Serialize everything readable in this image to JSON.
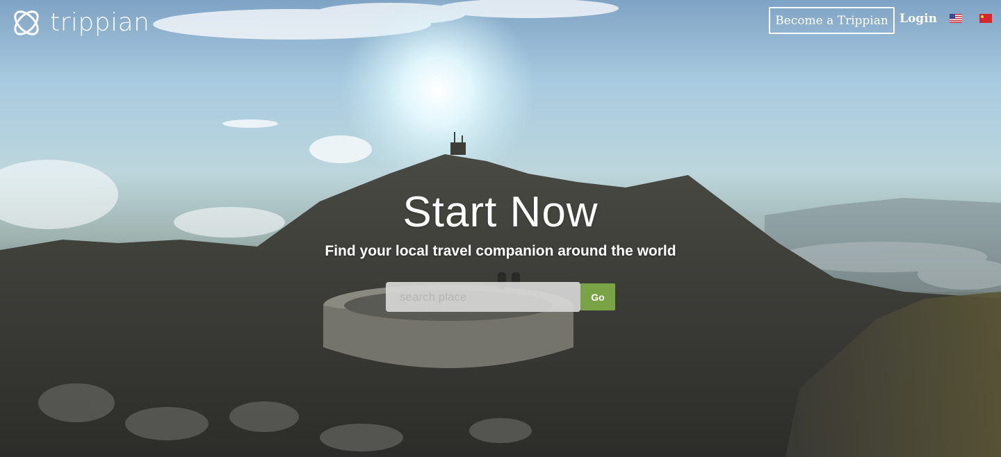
{
  "brand": {
    "name": "trippian"
  },
  "nav": {
    "become_label": "Become a Trippian",
    "login_label": "Login",
    "languages": [
      "English",
      "Chinese"
    ]
  },
  "hero": {
    "title": "Start Now",
    "subtitle": "Find your local travel companion around the world",
    "search": {
      "placeholder": "search place",
      "value": ""
    },
    "go_label": "Go"
  },
  "colors": {
    "go_button": "#79a344",
    "text": "#ffffff"
  },
  "icons": {
    "logo": "trippian-logo-icon",
    "flag_us": "flag-us-icon",
    "flag_cn": "flag-cn-icon"
  }
}
